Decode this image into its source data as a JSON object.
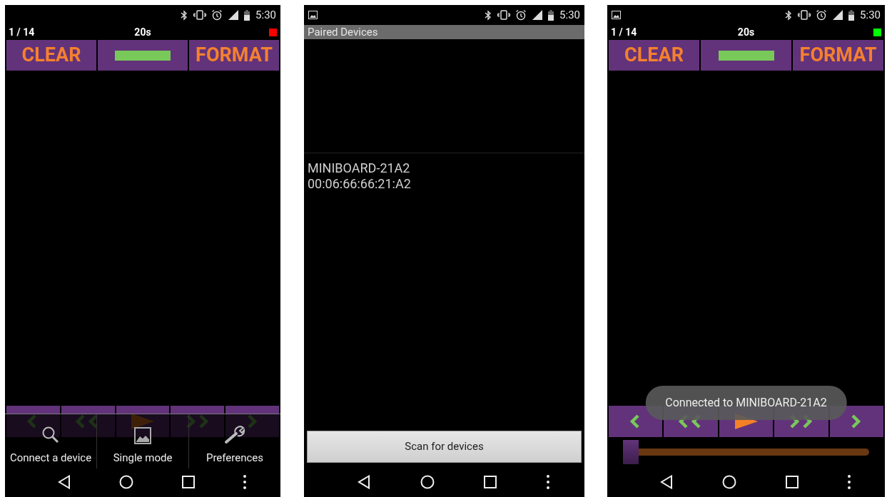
{
  "screens": [
    {
      "kind": "recorder",
      "status_bar": {
        "time": "5:30",
        "notification_icon": false
      },
      "counter": "1 / 14",
      "duration": "20s",
      "indicator": {
        "color": "#ff0000"
      },
      "buttons": [
        "CLEAR",
        "FORMAT"
      ],
      "menu": {
        "items": [
          {
            "label": "Connect a device"
          },
          {
            "label": "Single mode"
          },
          {
            "label": "Preferences"
          }
        ]
      }
    },
    {
      "kind": "devices",
      "status_bar": {
        "time": "5:30",
        "notification_icon": true
      },
      "header": "Paired Devices",
      "devices": [
        {
          "name": "MINIBOARD-21A2",
          "address": "00:06:66:66:21:A2"
        }
      ],
      "scan_button": "Scan for devices"
    },
    {
      "kind": "recorder",
      "status_bar": {
        "time": "5:30",
        "notification_icon": true
      },
      "counter": "1 / 14",
      "duration": "20s",
      "indicator": {
        "color": "#00ff00"
      },
      "buttons": [
        "CLEAR",
        "FORMAT"
      ],
      "slider": {
        "level": 0
      },
      "toast": "Connected to MINIBOARD-21A2"
    }
  ]
}
